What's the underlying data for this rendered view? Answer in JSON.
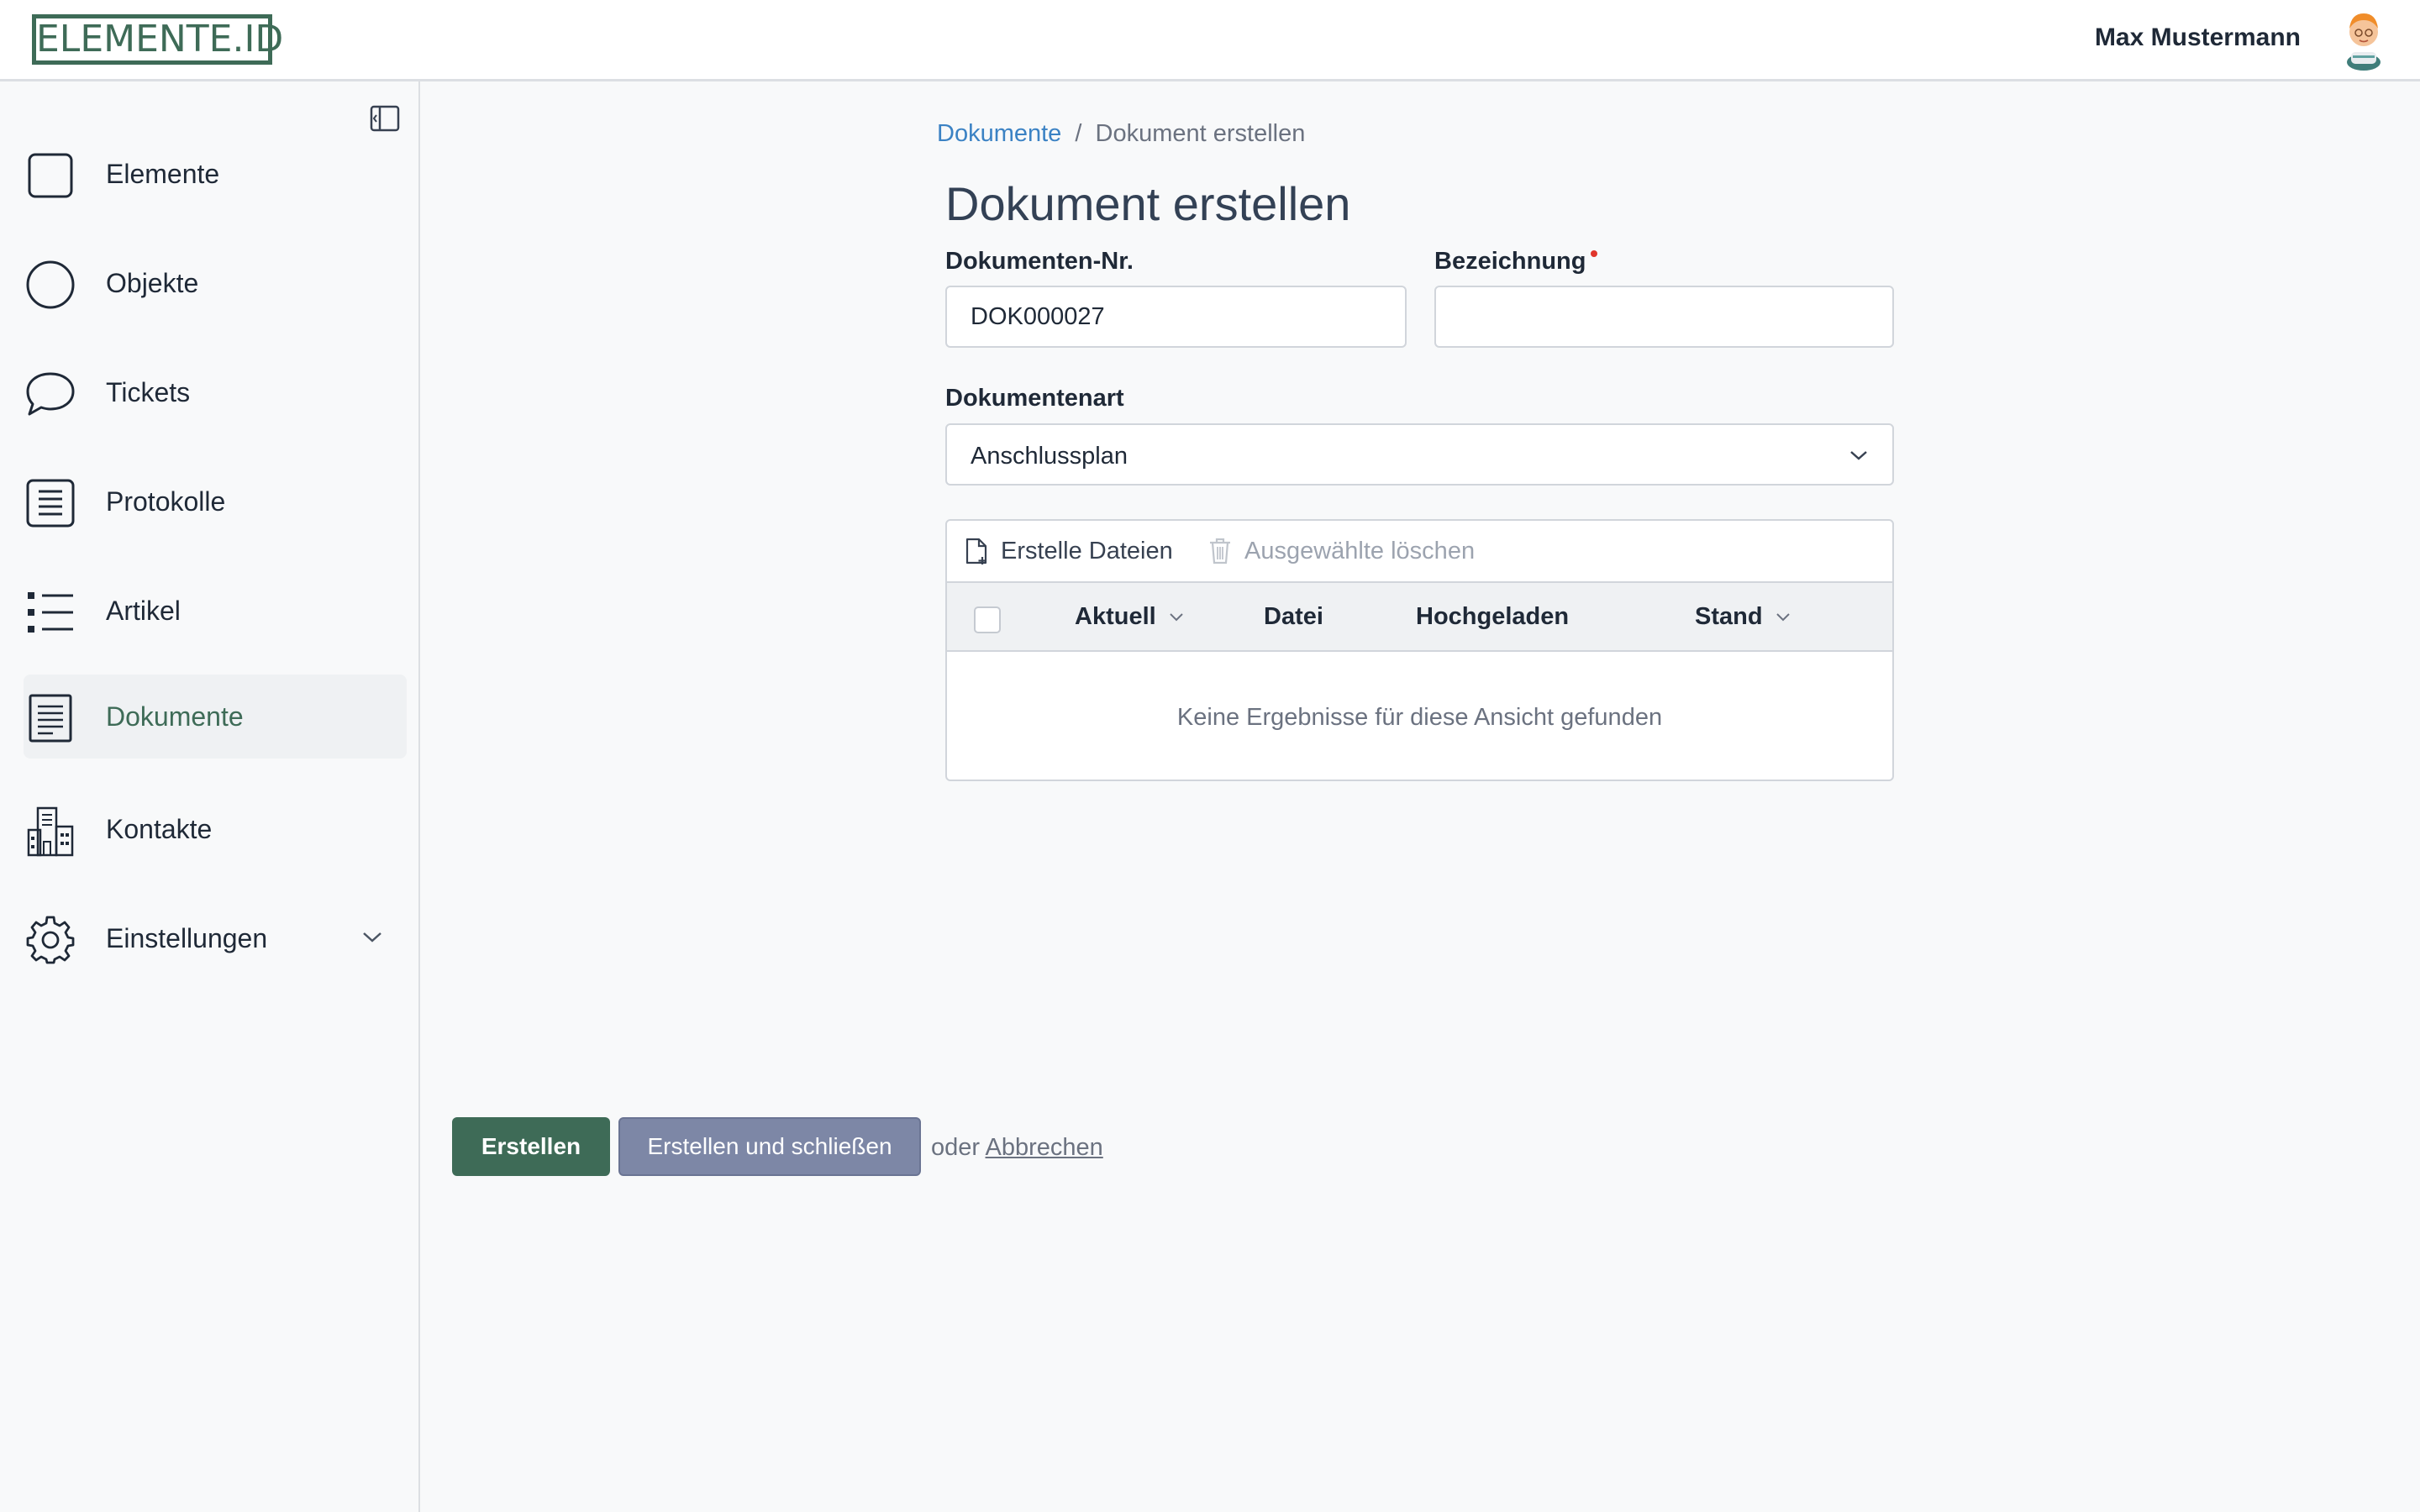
{
  "header": {
    "logo": "ELEMENTE.ID",
    "user_name": "Max Mustermann"
  },
  "sidebar": {
    "items": [
      {
        "label": "Elemente",
        "icon": "square-icon"
      },
      {
        "label": "Objekte",
        "icon": "circle-icon"
      },
      {
        "label": "Tickets",
        "icon": "chat-bubble-icon"
      },
      {
        "label": "Protokolle",
        "icon": "document-lines-icon"
      },
      {
        "label": "Artikel",
        "icon": "list-icon"
      },
      {
        "label": "Dokumente",
        "icon": "document-icon",
        "active": true
      },
      {
        "label": "Kontakte",
        "icon": "buildings-icon"
      },
      {
        "label": "Einstellungen",
        "icon": "gear-icon"
      }
    ]
  },
  "breadcrumb": {
    "parent": "Dokumente",
    "separator": "/",
    "current": "Dokument erstellen"
  },
  "page_title": "Dokument erstellen",
  "form": {
    "doc_number_label": "Dokumenten-Nr.",
    "doc_number_value": "DOK000027",
    "name_label": "Bezeichnung",
    "name_value": "",
    "doc_type_label": "Dokumentenart",
    "doc_type_value": "Anschlussplan"
  },
  "files_table": {
    "toolbar": {
      "create_label": "Erstelle Dateien",
      "delete_label": "Ausgewählte löschen"
    },
    "columns": [
      "Aktuell",
      "Datei",
      "Hochgeladen",
      "Stand"
    ],
    "empty_text": "Keine Ergebnisse für diese Ansicht gefunden"
  },
  "actions": {
    "create_label": "Erstellen",
    "create_close_label": "Erstellen und schließen",
    "or_text": "oder",
    "cancel_label": "Abbrechen"
  },
  "colors": {
    "brand": "#3e6b57",
    "secondary_button": "#7d87a6",
    "link": "#3b82c4",
    "required": "#e0352b"
  }
}
